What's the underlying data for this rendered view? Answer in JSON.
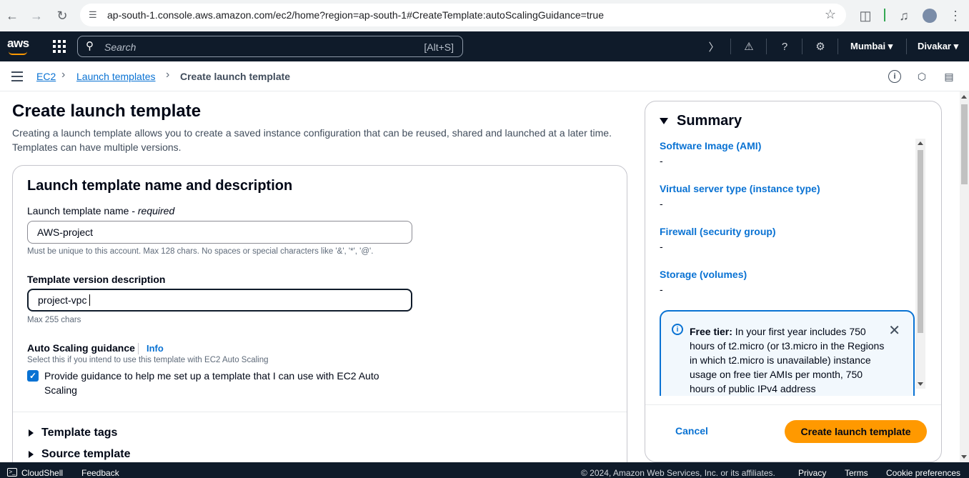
{
  "browser": {
    "url": "ap-south-1.console.aws.amazon.com/ec2/home?region=ap-south-1#CreateTemplate:autoScalingGuidance=true"
  },
  "topbar": {
    "logo": "aws",
    "search_placeholder": "Search",
    "search_shortcut": "[Alt+S]",
    "region": "Mumbai",
    "user": "Divakar"
  },
  "breadcrumb": {
    "items": [
      "EC2",
      "Launch templates",
      "Create launch template"
    ]
  },
  "page": {
    "title": "Create launch template",
    "description": "Creating a launch template allows you to create a saved instance configuration that can be reused, shared and launched at a later time. Templates can have multiple versions."
  },
  "form": {
    "section_title": "Launch template name and description",
    "name_label": "Launch template name - ",
    "name_required": "required",
    "name_value": "AWS-project",
    "name_hint": "Must be unique to this account. Max 128 chars. No spaces or special characters like '&', '*', '@'.",
    "desc_label": "Template version description",
    "desc_value": "project-vpc",
    "desc_hint": "Max 255 chars",
    "autoscaling_label": "Auto Scaling guidance",
    "autoscaling_info": "Info",
    "autoscaling_hint": "Select this if you intend to use this template with EC2 Auto Scaling",
    "autoscaling_checkbox": "Provide guidance to help me set up a template that I can use with EC2 Auto Scaling",
    "autoscaling_checked": true,
    "expanders": [
      "Template tags",
      "Source template"
    ]
  },
  "summary": {
    "title": "Summary",
    "items": [
      {
        "label": "Software Image (AMI)",
        "value": "-"
      },
      {
        "label": "Virtual server type (instance type)",
        "value": "-"
      },
      {
        "label": "Firewall (security group)",
        "value": "-"
      },
      {
        "label": "Storage (volumes)",
        "value": "-"
      }
    ],
    "free_tier_label": "Free tier:",
    "free_tier_text": " In your first year includes 750 hours of t2.micro (or t3.micro in the Regions in which t2.micro is unavailable) instance usage on free tier AMIs per month, 750 hours of public IPv4 address",
    "cancel": "Cancel",
    "create": "Create launch template"
  },
  "footer": {
    "cloudshell": "CloudShell",
    "feedback": "Feedback",
    "copyright": "© 2024, Amazon Web Services, Inc. or its affiliates.",
    "privacy": "Privacy",
    "terms": "Terms",
    "cookies": "Cookie preferences"
  },
  "colors": {
    "accent": "#0972d3",
    "primary_button": "#ff9900",
    "topbar": "#0f1b2a"
  }
}
